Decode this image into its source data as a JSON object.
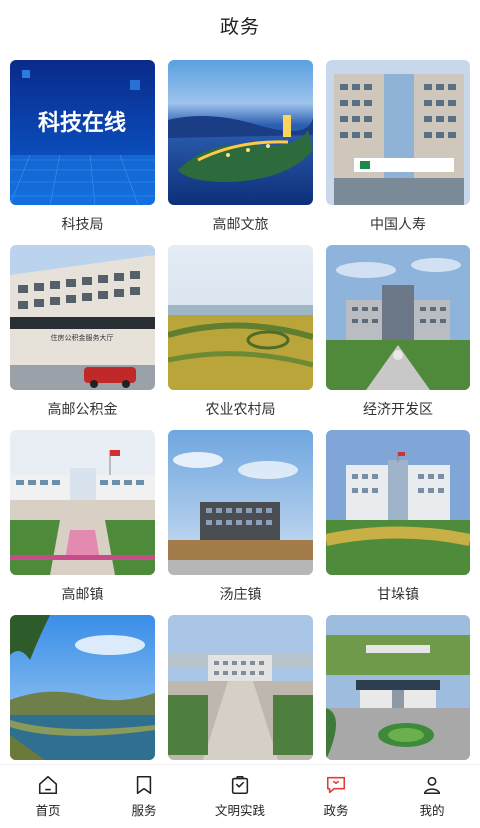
{
  "header": {
    "title": "政务"
  },
  "tiles": [
    {
      "label": "科技局",
      "image_text": "科技在线"
    },
    {
      "label": "高邮文旅"
    },
    {
      "label": "中国人寿"
    },
    {
      "label": "高邮公积金",
      "sign_text": "住房公积金服务大厅"
    },
    {
      "label": "农业农村局"
    },
    {
      "label": "经济开发区"
    },
    {
      "label": "高邮镇"
    },
    {
      "label": "汤庄镇"
    },
    {
      "label": "甘垛镇"
    },
    {
      "label": ""
    },
    {
      "label": ""
    },
    {
      "label": ""
    }
  ],
  "tabbar": {
    "items": [
      {
        "label": "首页",
        "icon": "home-icon"
      },
      {
        "label": "服务",
        "icon": "bookmark-icon"
      },
      {
        "label": "文明实践",
        "icon": "clipboard-icon"
      },
      {
        "label": "政务",
        "icon": "chat-flag-icon",
        "active": true
      },
      {
        "label": "我的",
        "icon": "person-icon"
      }
    ],
    "active_color": "#e53935",
    "icon_color": "#222222"
  }
}
